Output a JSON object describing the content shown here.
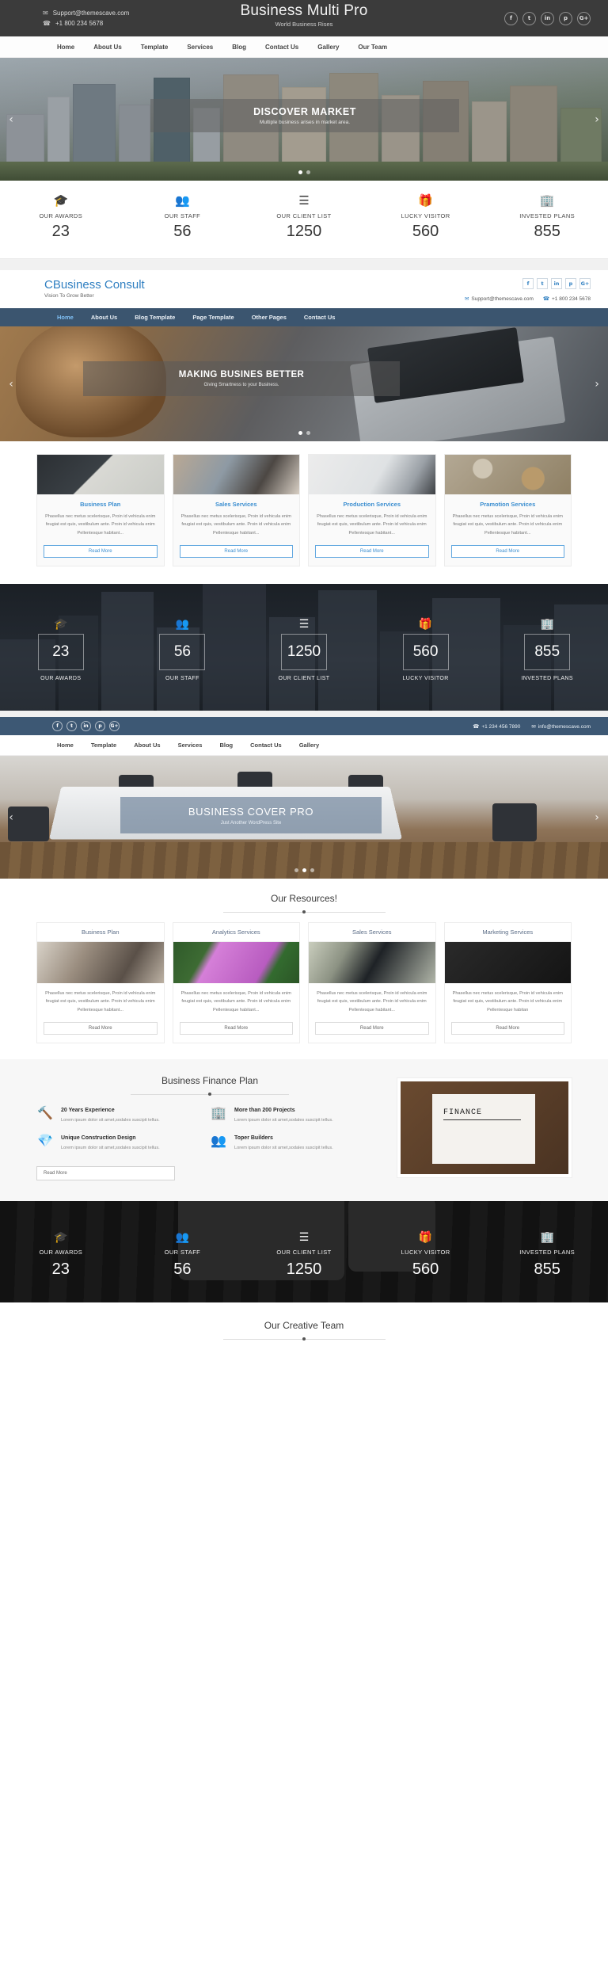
{
  "theme1": {
    "topbar": {
      "email": "Support@themescave.com",
      "phone": "+1 800 234 5678",
      "brand_title": "Business Multi Pro",
      "brand_sub": "World Business Rises",
      "socials": [
        "f",
        "t",
        "in",
        "p",
        "G+"
      ]
    },
    "nav": [
      "Home",
      "About Us",
      "Template",
      "Services",
      "Blog",
      "Contact Us",
      "Gallery",
      "Our Team"
    ],
    "hero": {
      "title": "DISCOVER MARKET",
      "subtitle": "Multiple business arises in market area.",
      "prev": "‹",
      "next": "›"
    },
    "counters": [
      {
        "icon": "🎓",
        "label": "OUR AWARDS",
        "value": "23"
      },
      {
        "icon": "👥",
        "label": "OUR STAFF",
        "value": "56"
      },
      {
        "icon": "☰",
        "label": "OUR CLIENT LIST",
        "value": "1250"
      },
      {
        "icon": "🎁",
        "label": "LUCKY VISITOR",
        "value": "560"
      },
      {
        "icon": "🏢",
        "label": "INVESTED PLANS",
        "value": "855"
      }
    ]
  },
  "theme2": {
    "header": {
      "brand_title": "CBusiness Consult",
      "brand_sub": "Vision To Grow Better",
      "email": "Support@themescave.com",
      "phone": "+1 800 234 5678",
      "socials": [
        "f",
        "t",
        "in",
        "p",
        "G+"
      ]
    },
    "nav": [
      "Home",
      "About Us",
      "Blog Template",
      "Page Template",
      "Other Pages",
      "Contact Us"
    ],
    "nav_active": "Home",
    "hero": {
      "title": "MAKING BUSINES BETTER",
      "subtitle": "Giving Smartness to your Business.",
      "prev": "‹",
      "next": "›"
    },
    "services": [
      {
        "title": "Business Plan",
        "text": "Phasellus nec metus scelerisque, Proin id vehicula enim feugiat est quis, vestibulum ante. Proin id vehicula enim Pellentesque habitant...",
        "button": "Read More"
      },
      {
        "title": "Sales Services",
        "text": "Phasellus nec metus scelerisque, Proin id vehicula enim feugiat est quis, vestibulum ante. Proin id vehicula enim Pellentesque habitant...",
        "button": "Read More"
      },
      {
        "title": "Production Services",
        "text": "Phasellus nec metus scelerisque, Proin id vehicula enim feugiat est quis, vestibulum ante. Proin id vehicula enim Pellentesque habitant...",
        "button": "Read More"
      },
      {
        "title": "Pramotion Services",
        "text": "Phasellus nec metus scelerisque, Proin id vehicula enim feugiat est quis, vestibulum ante. Proin id vehicula enim Pellentesque habitant...",
        "button": "Read More"
      }
    ],
    "counters": [
      {
        "icon": "🎓",
        "label": "OUR AWARDS",
        "value": "23"
      },
      {
        "icon": "👥",
        "label": "OUR STAFF",
        "value": "56"
      },
      {
        "icon": "☰",
        "label": "OUR CLIENT LIST",
        "value": "1250"
      },
      {
        "icon": "🎁",
        "label": "LUCKY VISITOR",
        "value": "560"
      },
      {
        "icon": "🏢",
        "label": "INVESTED PLANS",
        "value": "855"
      }
    ]
  },
  "theme3": {
    "topbar": {
      "phone": "+1 234 456 7890",
      "email": "info@themescave.com",
      "socials": [
        "f",
        "t",
        "in",
        "p",
        "G+"
      ]
    },
    "nav": [
      "Home",
      "Template",
      "About Us",
      "Services",
      "Blog",
      "Contact Us",
      "Gallery"
    ],
    "hero": {
      "title": "BUSINESS COVER PRO",
      "subtitle": "Just Another WordPress Site",
      "prev": "‹",
      "next": "›"
    },
    "resources": {
      "heading": "Our Resources!",
      "cards": [
        {
          "title": "Business Plan",
          "text": "Phasellus nec metus scelerisque, Proin id vehicula enim feugiat est quis, vestibulum ante. Proin id vehicula enim Pellentesque habitant...",
          "button": "Read More"
        },
        {
          "title": "Analytics Services",
          "text": "Phasellus nec metus scelerisque, Proin id vehicula enim feugiat est quis, vestibulum ante. Proin id vehicula enim Pellentesque habitant...",
          "button": "Read More"
        },
        {
          "title": "Sales Services",
          "text": "Phasellus nec metus scelerisque, Proin id vehicula enim feugiat est quis, vestibulum ante. Proin id vehicula enim Pellentesque habitant...",
          "button": "Read More"
        },
        {
          "title": "Marketing Services",
          "text": "Phasellus nec metus scelerisque, Proin id vehicula enim feugiat est quis, vestibulum ante. Proin id vehicula enim Pellentesque habitan",
          "button": "Read More"
        }
      ]
    },
    "finance": {
      "heading": "Business Finance Plan",
      "features": [
        {
          "icon": "🔨",
          "title": "20 Years Experience",
          "text": "Lorem ipsum dolor sit amet,sodales suscipit tellus."
        },
        {
          "icon": "🏢",
          "title": "More than 200 Projects",
          "text": "Lorem ipsum dolor sit amet,sodales suscipit tellus."
        },
        {
          "icon": "💎",
          "title": "Unique Construction Design",
          "text": "Lorem ipsum dolor sit amet,sodales suscipit tellus."
        },
        {
          "icon": "👥",
          "title": "Toper Builders",
          "text": "Lorem ipsum dolor sit amet,sodales suscipit tellus."
        }
      ],
      "button": "Read More",
      "image_word": "FINANCE"
    },
    "counters": [
      {
        "icon": "🎓",
        "label": "OUR AWARDS",
        "value": "23"
      },
      {
        "icon": "👥",
        "label": "OUR STAFF",
        "value": "56"
      },
      {
        "icon": "☰",
        "label": "OUR CLIENT LIST",
        "value": "1250"
      },
      {
        "icon": "🎁",
        "label": "LUCKY VISITOR",
        "value": "560"
      },
      {
        "icon": "🏢",
        "label": "INVESTED PLANS",
        "value": "855"
      }
    ],
    "team_heading": "Our Creative Team"
  },
  "colors": {
    "dark_bar": "#3b3b3b",
    "blue_brand": "#2f7fc1",
    "nav_blue": "#3b556f",
    "top_blue": "#3d5874"
  }
}
